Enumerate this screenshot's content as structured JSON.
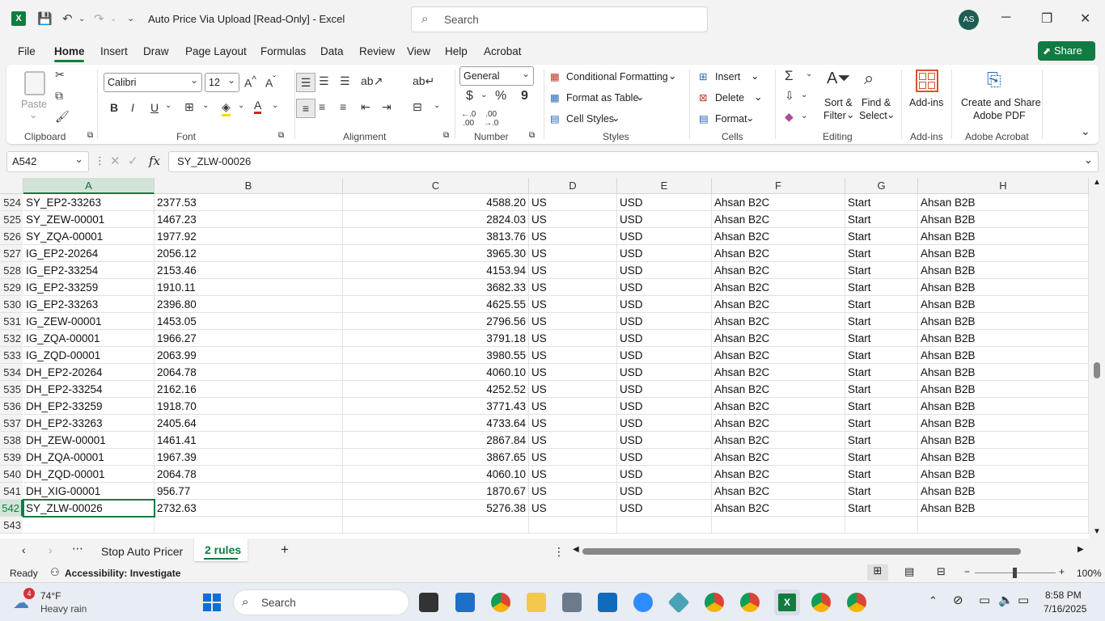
{
  "window": {
    "title": "Auto Price Via Upload  [Read-Only]  -  Excel",
    "search_placeholder": "Search",
    "avatar": "AS"
  },
  "menu": {
    "items": [
      "File",
      "Home",
      "Insert",
      "Draw",
      "Page Layout",
      "Formulas",
      "Data",
      "Review",
      "View",
      "Help",
      "Acrobat"
    ],
    "active": "Home",
    "share": "Share"
  },
  "ribbon": {
    "clipboard": {
      "paste": "Paste",
      "label": "Clipboard"
    },
    "font": {
      "name": "Calibri",
      "size": "12",
      "label": "Font",
      "bold": "B",
      "italic": "I",
      "underline": "U"
    },
    "alignment": {
      "label": "Alignment"
    },
    "number": {
      "format": "General",
      "label": "Number",
      "currency": "$",
      "percent": "%",
      "comma": "9"
    },
    "styles": {
      "conditional": "Conditional Formatting",
      "format_table": "Format as Table",
      "cell_styles": "Cell Styles",
      "label": "Styles"
    },
    "cells": {
      "insert": "Insert",
      "delete": "Delete",
      "format": "Format",
      "label": "Cells"
    },
    "editing": {
      "sort1": "Sort &",
      "sort2": "Filter",
      "find1": "Find &",
      "find2": "Select",
      "label": "Editing"
    },
    "addins": {
      "btn": "Add-ins",
      "label": "Add-ins"
    },
    "acrobat": {
      "btn1": "Create and Share",
      "btn2": "Adobe PDF",
      "label": "Adobe Acrobat"
    }
  },
  "formula_bar": {
    "name_box": "A542",
    "fx": "fx",
    "value": "SY_ZLW-00026"
  },
  "columns": [
    "A",
    "B",
    "C",
    "D",
    "E",
    "F",
    "G",
    "H"
  ],
  "rows": [
    {
      "n": "524",
      "a": "SY_EP2-33263",
      "b": "2377.53",
      "c": "4588.20",
      "d": "US",
      "e": "USD",
      "f": "Ahsan B2C",
      "g": "Start",
      "h": "Ahsan B2B"
    },
    {
      "n": "525",
      "a": "SY_ZEW-00001",
      "b": "1467.23",
      "c": "2824.03",
      "d": "US",
      "e": "USD",
      "f": "Ahsan B2C",
      "g": "Start",
      "h": "Ahsan B2B"
    },
    {
      "n": "526",
      "a": "SY_ZQA-00001",
      "b": "1977.92",
      "c": "3813.76",
      "d": "US",
      "e": "USD",
      "f": "Ahsan B2C",
      "g": "Start",
      "h": "Ahsan B2B"
    },
    {
      "n": "527",
      "a": "IG_EP2-20264",
      "b": "2056.12",
      "c": "3965.30",
      "d": "US",
      "e": "USD",
      "f": "Ahsan B2C",
      "g": "Start",
      "h": "Ahsan B2B"
    },
    {
      "n": "528",
      "a": "IG_EP2-33254",
      "b": "2153.46",
      "c": "4153.94",
      "d": "US",
      "e": "USD",
      "f": "Ahsan B2C",
      "g": "Start",
      "h": "Ahsan B2B"
    },
    {
      "n": "529",
      "a": "IG_EP2-33259",
      "b": "1910.11",
      "c": "3682.33",
      "d": "US",
      "e": "USD",
      "f": "Ahsan B2C",
      "g": "Start",
      "h": "Ahsan B2B"
    },
    {
      "n": "530",
      "a": "IG_EP2-33263",
      "b": "2396.80",
      "c": "4625.55",
      "d": "US",
      "e": "USD",
      "f": "Ahsan B2C",
      "g": "Start",
      "h": "Ahsan B2B"
    },
    {
      "n": "531",
      "a": "IG_ZEW-00001",
      "b": "1453.05",
      "c": "2796.56",
      "d": "US",
      "e": "USD",
      "f": "Ahsan B2C",
      "g": "Start",
      "h": "Ahsan B2B"
    },
    {
      "n": "532",
      "a": "IG_ZQA-00001",
      "b": "1966.27",
      "c": "3791.18",
      "d": "US",
      "e": "USD",
      "f": "Ahsan B2C",
      "g": "Start",
      "h": "Ahsan B2B"
    },
    {
      "n": "533",
      "a": "IG_ZQD-00001",
      "b": "2063.99",
      "c": "3980.55",
      "d": "US",
      "e": "USD",
      "f": "Ahsan B2C",
      "g": "Start",
      "h": "Ahsan B2B"
    },
    {
      "n": "534",
      "a": "DH_EP2-20264",
      "b": "2064.78",
      "c": "4060.10",
      "d": "US",
      "e": "USD",
      "f": "Ahsan B2C",
      "g": "Start",
      "h": "Ahsan B2B"
    },
    {
      "n": "535",
      "a": "DH_EP2-33254",
      "b": "2162.16",
      "c": "4252.52",
      "d": "US",
      "e": "USD",
      "f": "Ahsan B2C",
      "g": "Start",
      "h": "Ahsan B2B"
    },
    {
      "n": "536",
      "a": "DH_EP2-33259",
      "b": "1918.70",
      "c": "3771.43",
      "d": "US",
      "e": "USD",
      "f": "Ahsan B2C",
      "g": "Start",
      "h": "Ahsan B2B"
    },
    {
      "n": "537",
      "a": "DH_EP2-33263",
      "b": "2405.64",
      "c": "4733.64",
      "d": "US",
      "e": "USD",
      "f": "Ahsan B2C",
      "g": "Start",
      "h": "Ahsan B2B"
    },
    {
      "n": "538",
      "a": "DH_ZEW-00001",
      "b": "1461.41",
      "c": "2867.84",
      "d": "US",
      "e": "USD",
      "f": "Ahsan B2C",
      "g": "Start",
      "h": "Ahsan B2B"
    },
    {
      "n": "539",
      "a": "DH_ZQA-00001",
      "b": "1967.39",
      "c": "3867.65",
      "d": "US",
      "e": "USD",
      "f": "Ahsan B2C",
      "g": "Start",
      "h": "Ahsan B2B"
    },
    {
      "n": "540",
      "a": "DH_ZQD-00001",
      "b": "2064.78",
      "c": "4060.10",
      "d": "US",
      "e": "USD",
      "f": "Ahsan B2C",
      "g": "Start",
      "h": "Ahsan B2B"
    },
    {
      "n": "541",
      "a": "DH_XIG-00001",
      "b": "956.77",
      "c": "1870.67",
      "d": "US",
      "e": "USD",
      "f": "Ahsan B2C",
      "g": "Start",
      "h": "Ahsan B2B"
    },
    {
      "n": "542",
      "a": "SY_ZLW-00026",
      "b": "2732.63",
      "c": "5276.38",
      "d": "US",
      "e": "USD",
      "f": "Ahsan B2C",
      "g": "Start",
      "h": "Ahsan B2B"
    },
    {
      "n": "543",
      "a": "",
      "b": "",
      "c": "",
      "d": "",
      "e": "",
      "f": "",
      "g": "",
      "h": ""
    }
  ],
  "sheets": {
    "tabs": [
      "Stop Auto Pricer",
      "2 rules"
    ],
    "active": "2 rules"
  },
  "status": {
    "ready": "Ready",
    "accessibility": "Accessibility: Investigate",
    "zoom": "100%"
  },
  "taskbar": {
    "weather_temp": "74°F",
    "weather_desc": "Heavy rain",
    "weather_badge": "4",
    "search": "Search",
    "time": "8:58 PM",
    "date": "7/16/2025"
  }
}
